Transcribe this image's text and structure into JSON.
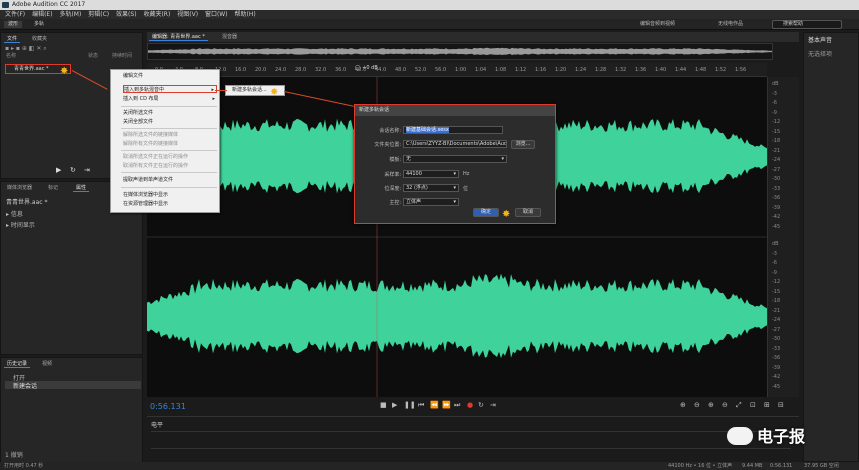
{
  "window": {
    "title": "Adobe Audition CC 2017"
  },
  "menubar": [
    "文件(F)",
    "编辑(E)",
    "多轨(M)",
    "剪辑(C)",
    "效果(S)",
    "收藏夹(R)",
    "视图(V)",
    "窗口(W)",
    "帮助(H)"
  ],
  "toolbar": {
    "mode_waveform": "波形",
    "mode_multitrack": "多轨",
    "workspaces": [
      "编辑音频到视频",
      "无线电作品"
    ],
    "search_placeholder": "搜索帮助"
  },
  "files_panel": {
    "tabs": [
      "文件",
      "收藏夹"
    ],
    "columns": [
      "名称",
      "状态",
      "持续时间"
    ],
    "file_name": "青青世界.aac *"
  },
  "context_menu": {
    "items": [
      {
        "label": "编辑文件",
        "enabled": true
      },
      {
        "label": "插入到多轨混音中",
        "enabled": true,
        "highlighted": true
      },
      {
        "label": "插入到 CD 布局",
        "enabled": true
      },
      {
        "label": "关闭所选文件",
        "enabled": true
      },
      {
        "label": "关闭全部文件",
        "enabled": true
      },
      {
        "label": "解除所选文件的链接媒体",
        "enabled": false
      },
      {
        "label": "解除所有文件的链接媒体",
        "enabled": false
      },
      {
        "label": "取消所选文件正在运行的操作",
        "enabled": false
      },
      {
        "label": "取消所有文件正在运行的操作",
        "enabled": false
      },
      {
        "label": "提取声道到单声道文件",
        "enabled": true
      },
      {
        "label": "在媒体浏览器中显示",
        "enabled": true
      },
      {
        "label": "在资源管理器中显示",
        "enabled": true
      }
    ],
    "submenu_item": "新建多轨会话..."
  },
  "props_panel": {
    "tabs": [
      "媒体浏览器",
      "标记",
      "属性"
    ],
    "file": "青青世界.aac *",
    "sections": [
      "信息",
      "时间显示"
    ]
  },
  "history_panel": {
    "tabs": [
      "历史记录",
      "视频"
    ],
    "items": [
      "打开",
      "新建会话"
    ],
    "status": "1 撤销"
  },
  "editor": {
    "tabs": [
      "编辑器: 青青世界.aac *",
      "混音器"
    ],
    "ruler_labels": [
      "0.0",
      "4.0",
      "8.0",
      "12.0",
      "16.0",
      "20.0",
      "24.0",
      "28.0",
      "32.0",
      "36.0",
      "40.0",
      "44.0",
      "48.0",
      "52.0",
      "56.0",
      "1:00",
      "1:04",
      "1:08",
      "1:12",
      "1:16",
      "1:20",
      "1:24",
      "1:28",
      "1:32",
      "1:36",
      "1:40",
      "1:44",
      "1:48",
      "1:52",
      "1:56"
    ],
    "hud_value": "+0 dB",
    "db_labels": [
      "dB",
      "-3",
      "-6",
      "-9",
      "-12",
      "-15",
      "-18",
      "-21",
      "-24",
      "-27",
      "-30",
      "-33",
      "-36",
      "-39",
      "-42",
      "-45"
    ],
    "time_display": "0:56.131",
    "waveform_color": "#3fd29a"
  },
  "dialog": {
    "title": "新建多轨会话",
    "session_name_label": "会话名称:",
    "session_name_value": "新建基础会话.sesx",
    "folder_label": "文件夹位置:",
    "folder_value": "C:\\Users\\ZYYZ-BI\\Documents\\Adobe\\Aud...",
    "browse": "浏览...",
    "template_label": "模板:",
    "template_value": "无",
    "samplerate_label": "采样率:",
    "samplerate_value": "44100",
    "samplerate_unit": "Hz",
    "bitdepth_label": "位深度:",
    "bitdepth_value": "32 (浮点)",
    "bitdepth_unit": "位",
    "master_label": "主控:",
    "master_value": "立体声",
    "ok": "确定",
    "cancel": "取消"
  },
  "levels": {
    "label": "电平"
  },
  "basic_sound": {
    "title": "基本声音",
    "subtitle": "无选择项"
  },
  "status_bar": {
    "left": "打开用时 0.47 秒",
    "right_items": [
      "44100 Hz • 16 位 • 立体声",
      "9.44 MB",
      "0:56.131",
      "37.95 GB 空闲"
    ]
  },
  "watermark": {
    "text": "电子报"
  }
}
